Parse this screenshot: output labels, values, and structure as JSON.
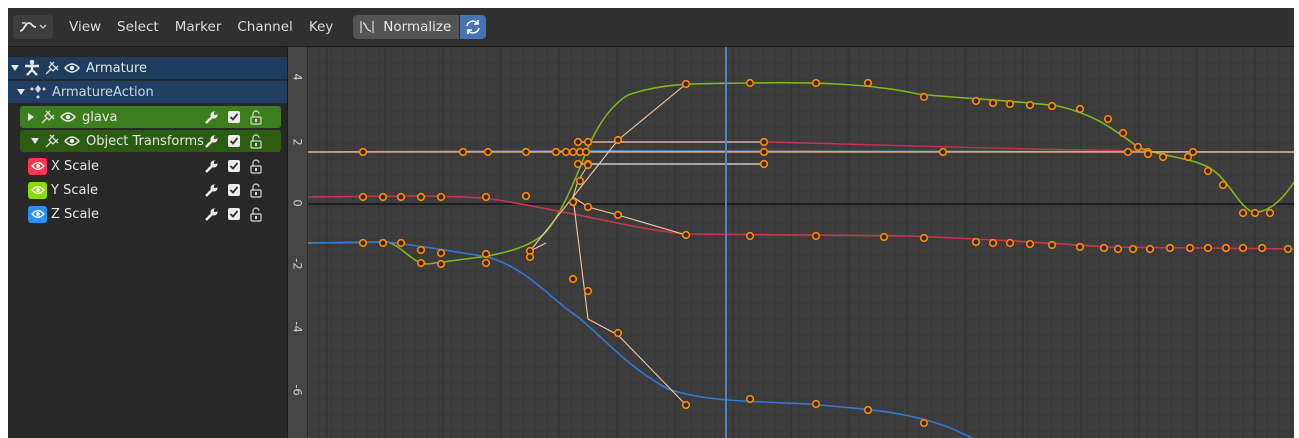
{
  "header": {
    "menus": [
      "View",
      "Select",
      "Marker",
      "Channel",
      "Key"
    ],
    "normalize_label": "Normalize"
  },
  "channels": {
    "armature": {
      "label": "Armature"
    },
    "action": {
      "label": "ArmatureAction"
    },
    "group": {
      "label": "glava"
    },
    "transform": {
      "label": "Object Transforms"
    },
    "x_scale": {
      "label": "X Scale",
      "color": "#ff3352"
    },
    "y_scale": {
      "label": "Y Scale",
      "color": "#8bdc00"
    },
    "z_scale": {
      "label": "Z Scale",
      "color": "#2890ff"
    }
  },
  "colors": {
    "armature_row": "#1d3c5e",
    "action_row": "#213f63",
    "group_row": "#3c7d1e",
    "transform_row": "#2c5c12",
    "playhead": "#5680c2",
    "keyframe": "#ff8c00"
  },
  "graph": {
    "y_tick_labels": [
      "4",
      "2",
      "0",
      "-2",
      "-4",
      "-6"
    ]
  }
}
